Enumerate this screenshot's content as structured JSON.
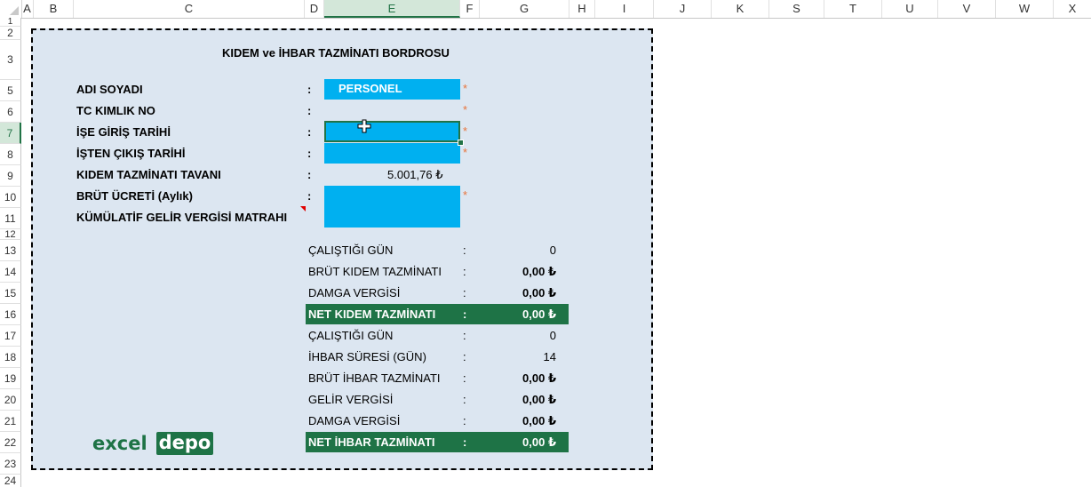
{
  "sheet": {
    "columns": [
      "A",
      "B",
      "C",
      "D",
      "E",
      "F",
      "G",
      "H",
      "I",
      "J",
      "K",
      "S",
      "T",
      "U",
      "V",
      "W",
      "X"
    ],
    "rows": [
      "1",
      "2",
      "3",
      "5",
      "6",
      "7",
      "8",
      "9",
      "10",
      "11",
      "12",
      "13",
      "14",
      "15",
      "16",
      "17",
      "18",
      "19",
      "20",
      "21",
      "22",
      "23",
      "24"
    ],
    "selected_column": "E",
    "selected_row": "7"
  },
  "form": {
    "title": "KIDEM ve İHBAR TAZMİNATI BORDROSU",
    "fields": [
      {
        "label": "ADI SOYADI",
        "value": "PERSONEL",
        "required": true
      },
      {
        "label": "TC KIMLIK NO",
        "value": "",
        "required": true
      },
      {
        "label": "İŞE GİRİŞ TARİHİ",
        "value": "",
        "required": true
      },
      {
        "label": "İŞTEN ÇIKIŞ TARİHİ",
        "value": "",
        "required": true
      },
      {
        "label": "KIDEM TAZMİNATI TAVANI",
        "value": "5.001,76 ₺",
        "required": false
      },
      {
        "label": "BRÜT ÜCRETİ (Aylık)",
        "value": "",
        "required": true
      },
      {
        "label": "KÜMÜLATİF GELİR VERGİSİ MATRAHI",
        "value": "",
        "required": false
      }
    ],
    "colon": ":",
    "required_mark": "*"
  },
  "kidem": [
    {
      "label": "ÇALIŞTIĞI GÜN",
      "value": "0"
    },
    {
      "label": "BRÜT KIDEM TAZMİNATI",
      "value": "0,00 ₺"
    },
    {
      "label": "DAMGA VERGİSİ",
      "value": "0,00 ₺"
    }
  ],
  "kidem_net": {
    "label": "NET KIDEM TAZMİNATI",
    "value": "0,00 ₺"
  },
  "ihbar": [
    {
      "label": "ÇALIŞTIĞI GÜN",
      "value": "0"
    },
    {
      "label": "İHBAR SÜRESİ (GÜN)",
      "value": "14"
    },
    {
      "label": "BRÜT İHBAR TAZMİNATI",
      "value": "0,00 ₺"
    },
    {
      "label": "GELİR VERGİSİ",
      "value": "0,00 ₺"
    },
    {
      "label": "DAMGA VERGİSİ",
      "value": "0,00 ₺"
    }
  ],
  "ihbar_net": {
    "label": "NET İHBAR TAZMİNATI",
    "value": "0,00 ₺"
  },
  "logo": {
    "part1": "excel",
    "part2": "depo"
  },
  "colors": {
    "accent_green": "#1e7346",
    "input_blue": "#00b0f0",
    "panel_bg": "#dce6f1",
    "required_star": "#e8743b"
  }
}
